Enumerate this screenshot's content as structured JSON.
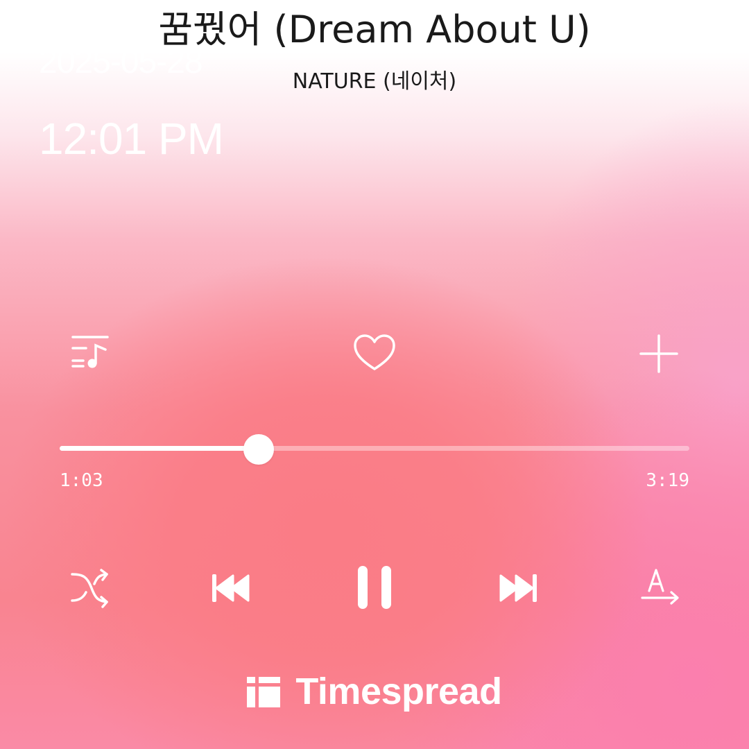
{
  "song": {
    "title": "꿈꿨어 (Dream About U)",
    "artist": "NATURE (네이처)"
  },
  "overlay": {
    "date": "2025-05-28",
    "time": "12:01 PM"
  },
  "actions": {
    "playlist_icon": "playlist-music-icon",
    "like_icon": "heart-outline-icon",
    "add_icon": "plus-icon"
  },
  "playback": {
    "elapsed": "1:03",
    "duration": "3:19",
    "progress_fraction": 0.316
  },
  "controls": {
    "shuffle_icon": "shuffle-icon",
    "previous_icon": "previous-track-icon",
    "pause_icon": "pause-icon",
    "next_icon": "next-track-icon",
    "lyrics_translate_icon": "translate-icon"
  },
  "brand": {
    "name": "Timespread",
    "logo_icon": "timespread-logo-icon"
  },
  "colors": {
    "accent": "#ffffff",
    "background_primary": "#f98490",
    "background_secondary": "#fb7fae",
    "text_dark": "#1a1a1a"
  }
}
